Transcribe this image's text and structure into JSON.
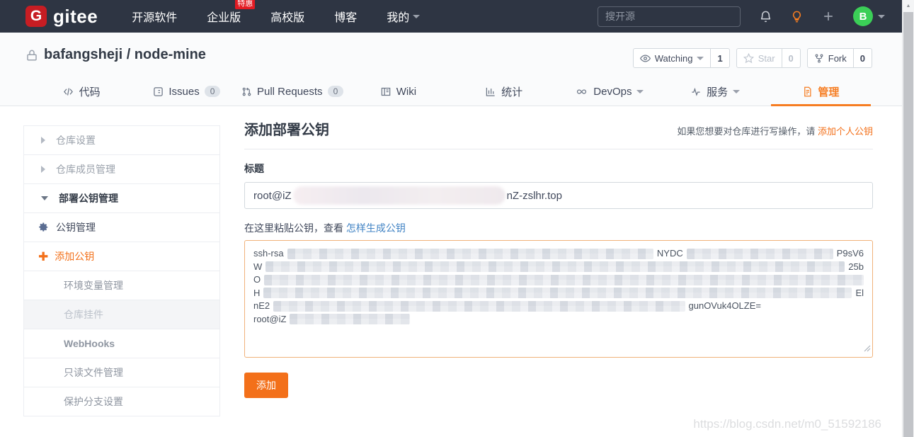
{
  "navbar": {
    "logo_letter": "G",
    "logo_text": "gitee",
    "items": [
      {
        "label": "开源软件"
      },
      {
        "label": "企业版",
        "badge": "特惠"
      },
      {
        "label": "高校版"
      },
      {
        "label": "博客"
      },
      {
        "label": "我的"
      }
    ],
    "search_placeholder": "搜开源",
    "avatar_letter": "B"
  },
  "repo_header": {
    "title": "bafangsheji / node-mine",
    "actions": [
      {
        "label": "Watching",
        "count": "1"
      },
      {
        "label": "Star",
        "count": "0"
      },
      {
        "label": "Fork",
        "count": "0"
      }
    ]
  },
  "tabs": [
    {
      "label": "代码"
    },
    {
      "label": "Issues",
      "badge": "0"
    },
    {
      "label": "Pull Requests",
      "badge": "0"
    },
    {
      "label": "Wiki"
    },
    {
      "label": "统计"
    },
    {
      "label": "DevOps"
    },
    {
      "label": "服务"
    },
    {
      "label": "管理"
    }
  ],
  "sidebar": {
    "items": [
      {
        "label": "仓库设置"
      },
      {
        "label": "仓库成员管理"
      },
      {
        "label": "部署公钥管理"
      },
      {
        "label": "公钥管理"
      },
      {
        "label": "添加公钥"
      },
      {
        "label": "环境变量管理"
      },
      {
        "label": "仓库挂件"
      },
      {
        "label": "WebHooks"
      },
      {
        "label": "只读文件管理"
      },
      {
        "label": "保护分支设置"
      }
    ]
  },
  "main": {
    "title": "添加部署公钥",
    "hint_prefix": "如果您想要对仓库进行写操作，请 ",
    "hint_link": "添加个人公钥",
    "field_label": "标题",
    "title_input_prefix": "root@iZ",
    "title_input_suffix": "nZ-zslhr.top",
    "paste_hint_prefix": "在这里粘贴公钥，查看 ",
    "paste_hint_link": "怎样生成公钥",
    "key_fragments": {
      "l1a": "ssh-rsa",
      "l1b": "NYDC",
      "l1c": "P9sV6",
      "l2a": "W",
      "l2b": "25b",
      "l3a": "O",
      "l4a": "H",
      "l4b": "El",
      "l5a": "nE2",
      "l5b": "gunOVuk4OLZE=",
      "l6a": "root@iZ"
    },
    "add_button": "添加"
  },
  "watermark": "https://blog.csdn.net/m0_51592186",
  "colors": {
    "navbar_bg": "#2e3543",
    "accent_orange": "#f3701a",
    "tab_active_orange": "#f67d22",
    "badge_red": "#e31b23",
    "avatar_green": "#3bcf57",
    "link_blue": "#4183c4"
  }
}
